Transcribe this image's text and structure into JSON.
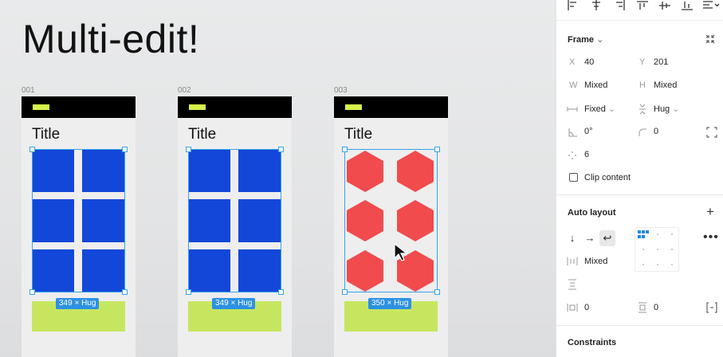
{
  "canvas": {
    "heading": "Multi-edit!",
    "frames": [
      {
        "label": "001",
        "title": "Title",
        "size_badge": "349 × Hug",
        "content": "grid"
      },
      {
        "label": "002",
        "title": "Title",
        "size_badge": "349 × Hug",
        "content": "grid"
      },
      {
        "label": "003",
        "title": "Title",
        "size_badge": "350 × Hug",
        "content": "hexagons"
      }
    ],
    "colors": {
      "tile_blue": "#1347d9",
      "hex_red": "#f14b4e",
      "lime": "#c7e660",
      "chip": "#d6f24a",
      "selection": "#38a2e8"
    }
  },
  "panel": {
    "frame_section": {
      "title": "Frame",
      "x_label": "X",
      "x_value": "40",
      "y_label": "Y",
      "y_value": "201",
      "w_label": "W",
      "w_value": "Mixed",
      "h_label": "H",
      "h_value": "Mixed",
      "width_mode": "Fixed",
      "height_mode": "Hug",
      "rotation": "0°",
      "radius": "0",
      "spacing": "6",
      "clip_content": "Clip content"
    },
    "auto_layout": {
      "title": "Auto layout",
      "gap": "Mixed",
      "padding_h": "0",
      "padding_v": "0"
    },
    "constraints": {
      "title": "Constraints"
    }
  }
}
